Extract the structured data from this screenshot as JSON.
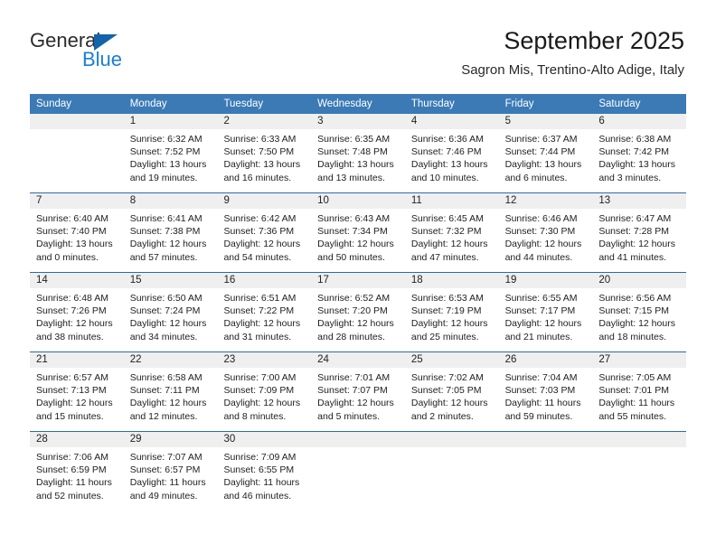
{
  "brand": {
    "name_top": "General",
    "name_bottom": "Blue",
    "accent_color": "#1464aa",
    "blue_text_color": "#1a7fd4"
  },
  "header": {
    "title": "September 2025",
    "subtitle": "Sagron Mis, Trentino-Alto Adige, Italy"
  },
  "theme": {
    "header_row_bg": "#3b7ab5",
    "week_divider": "#2b6ca8",
    "daynum_bg": "#efefef"
  },
  "weekdays": [
    "Sunday",
    "Monday",
    "Tuesday",
    "Wednesday",
    "Thursday",
    "Friday",
    "Saturday"
  ],
  "weeks": [
    {
      "days": [
        {
          "num": "",
          "empty": true,
          "sunrise": "",
          "sunset": "",
          "daylight1": "",
          "daylight2": ""
        },
        {
          "num": "1",
          "empty": false,
          "sunrise": "Sunrise: 6:32 AM",
          "sunset": "Sunset: 7:52 PM",
          "daylight1": "Daylight: 13 hours",
          "daylight2": "and 19 minutes."
        },
        {
          "num": "2",
          "empty": false,
          "sunrise": "Sunrise: 6:33 AM",
          "sunset": "Sunset: 7:50 PM",
          "daylight1": "Daylight: 13 hours",
          "daylight2": "and 16 minutes."
        },
        {
          "num": "3",
          "empty": false,
          "sunrise": "Sunrise: 6:35 AM",
          "sunset": "Sunset: 7:48 PM",
          "daylight1": "Daylight: 13 hours",
          "daylight2": "and 13 minutes."
        },
        {
          "num": "4",
          "empty": false,
          "sunrise": "Sunrise: 6:36 AM",
          "sunset": "Sunset: 7:46 PM",
          "daylight1": "Daylight: 13 hours",
          "daylight2": "and 10 minutes."
        },
        {
          "num": "5",
          "empty": false,
          "sunrise": "Sunrise: 6:37 AM",
          "sunset": "Sunset: 7:44 PM",
          "daylight1": "Daylight: 13 hours",
          "daylight2": "and 6 minutes."
        },
        {
          "num": "6",
          "empty": false,
          "sunrise": "Sunrise: 6:38 AM",
          "sunset": "Sunset: 7:42 PM",
          "daylight1": "Daylight: 13 hours",
          "daylight2": "and 3 minutes."
        }
      ]
    },
    {
      "days": [
        {
          "num": "7",
          "empty": false,
          "sunrise": "Sunrise: 6:40 AM",
          "sunset": "Sunset: 7:40 PM",
          "daylight1": "Daylight: 13 hours",
          "daylight2": "and 0 minutes."
        },
        {
          "num": "8",
          "empty": false,
          "sunrise": "Sunrise: 6:41 AM",
          "sunset": "Sunset: 7:38 PM",
          "daylight1": "Daylight: 12 hours",
          "daylight2": "and 57 minutes."
        },
        {
          "num": "9",
          "empty": false,
          "sunrise": "Sunrise: 6:42 AM",
          "sunset": "Sunset: 7:36 PM",
          "daylight1": "Daylight: 12 hours",
          "daylight2": "and 54 minutes."
        },
        {
          "num": "10",
          "empty": false,
          "sunrise": "Sunrise: 6:43 AM",
          "sunset": "Sunset: 7:34 PM",
          "daylight1": "Daylight: 12 hours",
          "daylight2": "and 50 minutes."
        },
        {
          "num": "11",
          "empty": false,
          "sunrise": "Sunrise: 6:45 AM",
          "sunset": "Sunset: 7:32 PM",
          "daylight1": "Daylight: 12 hours",
          "daylight2": "and 47 minutes."
        },
        {
          "num": "12",
          "empty": false,
          "sunrise": "Sunrise: 6:46 AM",
          "sunset": "Sunset: 7:30 PM",
          "daylight1": "Daylight: 12 hours",
          "daylight2": "and 44 minutes."
        },
        {
          "num": "13",
          "empty": false,
          "sunrise": "Sunrise: 6:47 AM",
          "sunset": "Sunset: 7:28 PM",
          "daylight1": "Daylight: 12 hours",
          "daylight2": "and 41 minutes."
        }
      ]
    },
    {
      "days": [
        {
          "num": "14",
          "empty": false,
          "sunrise": "Sunrise: 6:48 AM",
          "sunset": "Sunset: 7:26 PM",
          "daylight1": "Daylight: 12 hours",
          "daylight2": "and 38 minutes."
        },
        {
          "num": "15",
          "empty": false,
          "sunrise": "Sunrise: 6:50 AM",
          "sunset": "Sunset: 7:24 PM",
          "daylight1": "Daylight: 12 hours",
          "daylight2": "and 34 minutes."
        },
        {
          "num": "16",
          "empty": false,
          "sunrise": "Sunrise: 6:51 AM",
          "sunset": "Sunset: 7:22 PM",
          "daylight1": "Daylight: 12 hours",
          "daylight2": "and 31 minutes."
        },
        {
          "num": "17",
          "empty": false,
          "sunrise": "Sunrise: 6:52 AM",
          "sunset": "Sunset: 7:20 PM",
          "daylight1": "Daylight: 12 hours",
          "daylight2": "and 28 minutes."
        },
        {
          "num": "18",
          "empty": false,
          "sunrise": "Sunrise: 6:53 AM",
          "sunset": "Sunset: 7:19 PM",
          "daylight1": "Daylight: 12 hours",
          "daylight2": "and 25 minutes."
        },
        {
          "num": "19",
          "empty": false,
          "sunrise": "Sunrise: 6:55 AM",
          "sunset": "Sunset: 7:17 PM",
          "daylight1": "Daylight: 12 hours",
          "daylight2": "and 21 minutes."
        },
        {
          "num": "20",
          "empty": false,
          "sunrise": "Sunrise: 6:56 AM",
          "sunset": "Sunset: 7:15 PM",
          "daylight1": "Daylight: 12 hours",
          "daylight2": "and 18 minutes."
        }
      ]
    },
    {
      "days": [
        {
          "num": "21",
          "empty": false,
          "sunrise": "Sunrise: 6:57 AM",
          "sunset": "Sunset: 7:13 PM",
          "daylight1": "Daylight: 12 hours",
          "daylight2": "and 15 minutes."
        },
        {
          "num": "22",
          "empty": false,
          "sunrise": "Sunrise: 6:58 AM",
          "sunset": "Sunset: 7:11 PM",
          "daylight1": "Daylight: 12 hours",
          "daylight2": "and 12 minutes."
        },
        {
          "num": "23",
          "empty": false,
          "sunrise": "Sunrise: 7:00 AM",
          "sunset": "Sunset: 7:09 PM",
          "daylight1": "Daylight: 12 hours",
          "daylight2": "and 8 minutes."
        },
        {
          "num": "24",
          "empty": false,
          "sunrise": "Sunrise: 7:01 AM",
          "sunset": "Sunset: 7:07 PM",
          "daylight1": "Daylight: 12 hours",
          "daylight2": "and 5 minutes."
        },
        {
          "num": "25",
          "empty": false,
          "sunrise": "Sunrise: 7:02 AM",
          "sunset": "Sunset: 7:05 PM",
          "daylight1": "Daylight: 12 hours",
          "daylight2": "and 2 minutes."
        },
        {
          "num": "26",
          "empty": false,
          "sunrise": "Sunrise: 7:04 AM",
          "sunset": "Sunset: 7:03 PM",
          "daylight1": "Daylight: 11 hours",
          "daylight2": "and 59 minutes."
        },
        {
          "num": "27",
          "empty": false,
          "sunrise": "Sunrise: 7:05 AM",
          "sunset": "Sunset: 7:01 PM",
          "daylight1": "Daylight: 11 hours",
          "daylight2": "and 55 minutes."
        }
      ]
    },
    {
      "days": [
        {
          "num": "28",
          "empty": false,
          "sunrise": "Sunrise: 7:06 AM",
          "sunset": "Sunset: 6:59 PM",
          "daylight1": "Daylight: 11 hours",
          "daylight2": "and 52 minutes."
        },
        {
          "num": "29",
          "empty": false,
          "sunrise": "Sunrise: 7:07 AM",
          "sunset": "Sunset: 6:57 PM",
          "daylight1": "Daylight: 11 hours",
          "daylight2": "and 49 minutes."
        },
        {
          "num": "30",
          "empty": false,
          "sunrise": "Sunrise: 7:09 AM",
          "sunset": "Sunset: 6:55 PM",
          "daylight1": "Daylight: 11 hours",
          "daylight2": "and 46 minutes."
        },
        {
          "num": "",
          "empty": true,
          "sunrise": "",
          "sunset": "",
          "daylight1": "",
          "daylight2": ""
        },
        {
          "num": "",
          "empty": true,
          "sunrise": "",
          "sunset": "",
          "daylight1": "",
          "daylight2": ""
        },
        {
          "num": "",
          "empty": true,
          "sunrise": "",
          "sunset": "",
          "daylight1": "",
          "daylight2": ""
        },
        {
          "num": "",
          "empty": true,
          "sunrise": "",
          "sunset": "",
          "daylight1": "",
          "daylight2": ""
        }
      ]
    }
  ]
}
